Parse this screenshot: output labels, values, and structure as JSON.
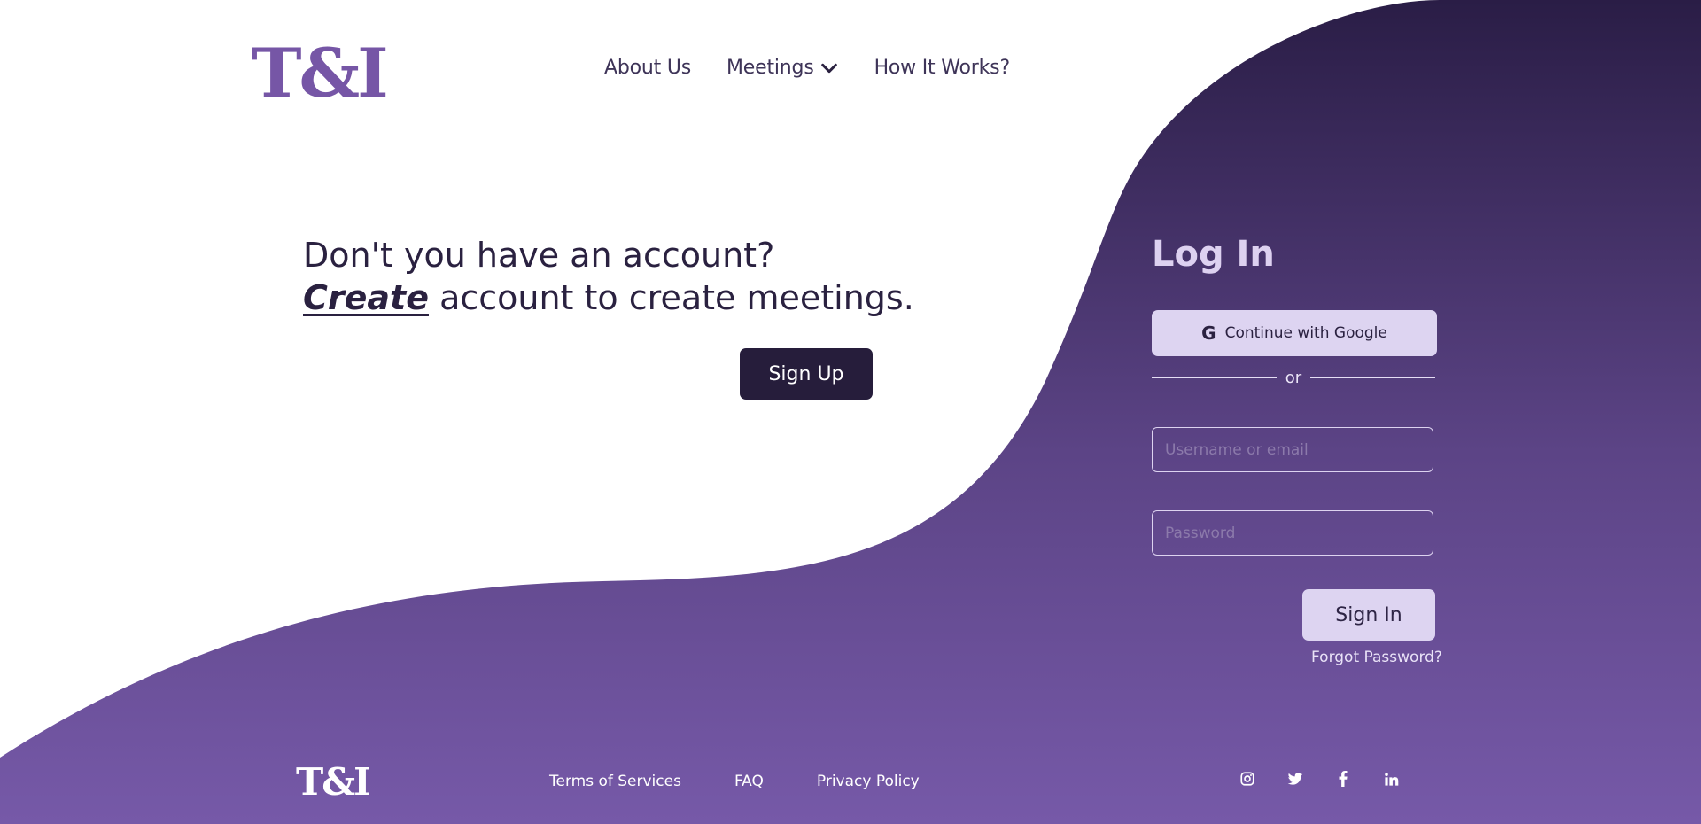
{
  "header": {
    "logo": "T&I",
    "nav": {
      "about": "About Us",
      "meetings": "Meetings",
      "how": "How It Works?"
    }
  },
  "hero": {
    "line1": "Don't you have an account?",
    "create": "Create",
    "line2_rest": " account to create meetings.",
    "signup_label": "Sign Up"
  },
  "login": {
    "title": "Log In",
    "google_label": "Continue with Google",
    "or": "or",
    "username_placeholder": "Username or email",
    "password_placeholder": "Password",
    "signin_label": "Sign In",
    "forgot": "Forgot Password?"
  },
  "footer": {
    "logo": "T&I",
    "links": [
      "Terms of Services",
      "FAQ",
      "Privacy Policy"
    ],
    "socials": [
      "instagram-icon",
      "twitter-icon",
      "facebook-icon",
      "linkedin-icon"
    ]
  },
  "colors": {
    "brand_purple": "#7656a6",
    "dark": "#261d3b",
    "gradient_top": "#2a1d46",
    "gradient_bottom": "#7659a8",
    "light_lavender": "#ddd4f1"
  }
}
